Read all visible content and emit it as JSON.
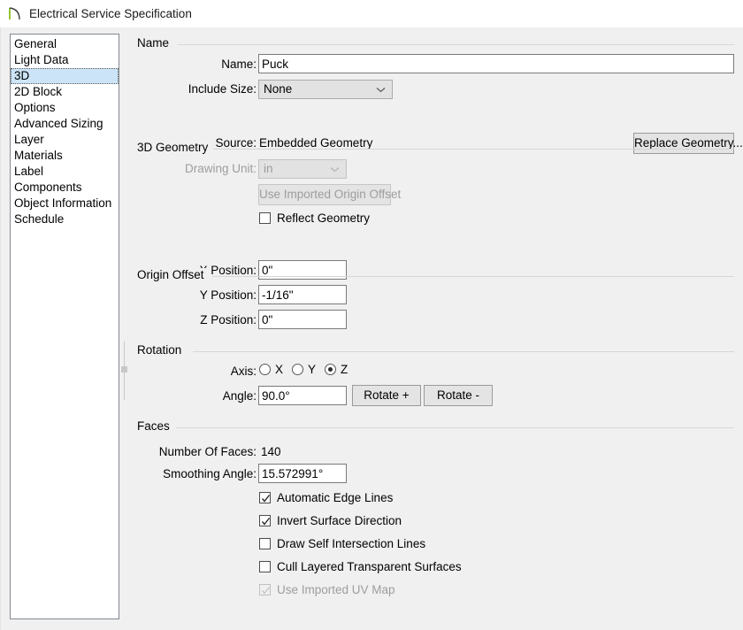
{
  "window": {
    "title": "Electrical Service Specification",
    "icon": "arc-curve-icon"
  },
  "colors": {
    "window_bg": "#f0f0f0",
    "titlebar_bg": "#ffffff",
    "selection_bg": "#cce4f7",
    "field_bg": "#ffffff",
    "disabled_text": "#9d9d9d",
    "icon_accent": "#7ab800"
  },
  "sidebar": {
    "selected": "3D",
    "items": [
      {
        "label": "General"
      },
      {
        "label": "Light Data"
      },
      {
        "label": "3D"
      },
      {
        "label": "2D Block"
      },
      {
        "label": "Options"
      },
      {
        "label": "Advanced Sizing"
      },
      {
        "label": "Layer"
      },
      {
        "label": "Materials"
      },
      {
        "label": "Label"
      },
      {
        "label": "Components"
      },
      {
        "label": "Object Information"
      },
      {
        "label": "Schedule"
      }
    ]
  },
  "groups": {
    "name": {
      "label": "Name",
      "name_field": {
        "label": "Name:",
        "value": "Puck",
        "placeholder": ""
      },
      "include_size": {
        "label": "Include Size:",
        "value": "None",
        "options": [
          "None"
        ]
      }
    },
    "geometry": {
      "label": "3D Geometry",
      "source": {
        "label": "Source:",
        "value": "Embedded Geometry"
      },
      "replace_button": {
        "label": "Replace Geometry..."
      },
      "drawing_unit": {
        "label": "Drawing Unit:",
        "value": "in",
        "options": [
          "in"
        ],
        "disabled": true
      },
      "use_imported_origin_offset": {
        "label": "Use Imported Origin Offset",
        "disabled": true
      },
      "reflect_geometry": {
        "label": "Reflect Geometry",
        "checked": false
      }
    },
    "origin_offset": {
      "label": "Origin Offset",
      "x_position": {
        "label": "X Position:",
        "value": "0\""
      },
      "y_position": {
        "label": "Y Position:",
        "value": "-1/16\""
      },
      "z_position": {
        "label": "Z Position:",
        "value": "0\""
      }
    },
    "rotation": {
      "label": "Rotation",
      "axis": {
        "label": "Axis:",
        "selected": "Z",
        "options": [
          {
            "label": "X",
            "checked": false
          },
          {
            "label": "Y",
            "checked": false
          },
          {
            "label": "Z",
            "checked": true
          }
        ]
      },
      "angle": {
        "label": "Angle:",
        "value": "90.0°"
      },
      "rotate_plus": {
        "label": "Rotate +"
      },
      "rotate_minus": {
        "label": "Rotate -"
      }
    },
    "faces": {
      "label": "Faces",
      "number_of_faces": {
        "label": "Number Of Faces:",
        "value": "140"
      },
      "smoothing_angle": {
        "label": "Smoothing Angle:",
        "value": "15.572991°"
      },
      "checkboxes": [
        {
          "label": "Automatic Edge Lines",
          "checked": true,
          "disabled": false
        },
        {
          "label": "Invert Surface Direction",
          "checked": true,
          "disabled": false
        },
        {
          "label": "Draw Self Intersection Lines",
          "checked": false,
          "disabled": false
        },
        {
          "label": "Cull Layered Transparent Surfaces",
          "checked": false,
          "disabled": false
        },
        {
          "label": "Use Imported UV Map",
          "checked": true,
          "disabled": true
        }
      ]
    }
  }
}
